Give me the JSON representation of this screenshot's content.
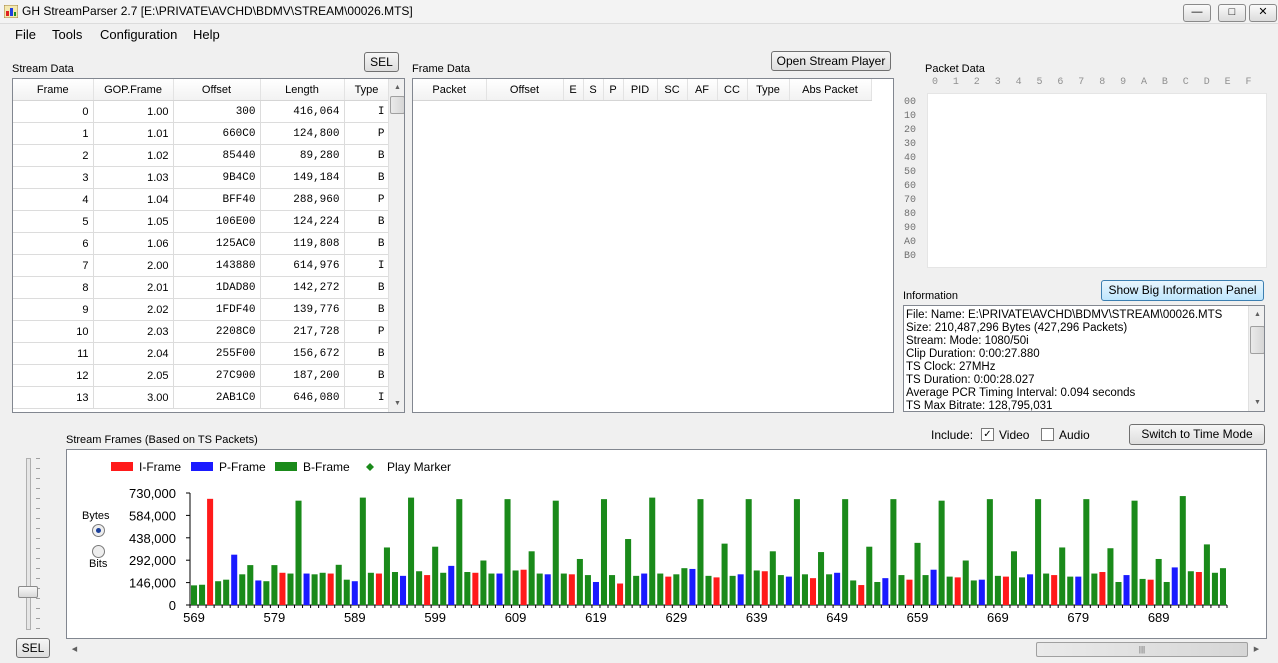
{
  "window": {
    "title": "GH StreamParser 2.7 [E:\\PRIVATE\\AVCHD\\BDMV\\STREAM\\00026.MTS]",
    "minimize": "—",
    "maximize": "□",
    "close": "✕"
  },
  "menu": [
    "File",
    "Tools",
    "Configuration",
    "Help"
  ],
  "stream_data": {
    "label": "Stream Data",
    "sel_label": "SEL",
    "columns": [
      "Frame",
      "GOP.Frame",
      "Offset",
      "Length",
      "Type"
    ],
    "rows": [
      [
        "0",
        "1.00",
        "300",
        "416,064",
        "I"
      ],
      [
        "1",
        "1.01",
        "660C0",
        "124,800",
        "P"
      ],
      [
        "2",
        "1.02",
        "85440",
        "89,280",
        "B"
      ],
      [
        "3",
        "1.03",
        "9B4C0",
        "149,184",
        "B"
      ],
      [
        "4",
        "1.04",
        "BFF40",
        "288,960",
        "P"
      ],
      [
        "5",
        "1.05",
        "106E00",
        "124,224",
        "B"
      ],
      [
        "6",
        "1.06",
        "125AC0",
        "119,808",
        "B"
      ],
      [
        "7",
        "2.00",
        "143880",
        "614,976",
        "I"
      ],
      [
        "8",
        "2.01",
        "1DAD80",
        "142,272",
        "B"
      ],
      [
        "9",
        "2.02",
        "1FDF40",
        "139,776",
        "B"
      ],
      [
        "10",
        "2.03",
        "2208C0",
        "217,728",
        "P"
      ],
      [
        "11",
        "2.04",
        "255F00",
        "156,672",
        "B"
      ],
      [
        "12",
        "2.05",
        "27C900",
        "187,200",
        "B"
      ],
      [
        "13",
        "3.00",
        "2AB1C0",
        "646,080",
        "I"
      ]
    ]
  },
  "frame_data": {
    "label": "Frame Data",
    "open_player_label": "Open Stream Player",
    "columns": [
      "Packet",
      "Offset",
      "E",
      "S",
      "P",
      "PID",
      "SC",
      "AF",
      "CC",
      "Type",
      "Abs Packet"
    ]
  },
  "packet_data": {
    "label": "Packet Data",
    "hex_columns": [
      "0",
      "1",
      "2",
      "3",
      "4",
      "5",
      "6",
      "7",
      "8",
      "9",
      "A",
      "B",
      "C",
      "D",
      "E",
      "F"
    ],
    "row_labels": [
      "00",
      "10",
      "20",
      "30",
      "40",
      "50",
      "60",
      "70",
      "80",
      "90",
      "A0",
      "B0"
    ]
  },
  "information": {
    "label": "Information",
    "big_panel_label": "Show Big Information Panel",
    "lines": [
      "File:   Name: E:\\PRIVATE\\AVCHD\\BDMV\\STREAM\\00026.MTS",
      "    Size: 210,487,296 Bytes (427,296 Packets)",
      "Stream: Mode: 1080/50i",
      "    Clip Duration: 0:00:27.880",
      "    TS Clock: 27MHz",
      "    TS Duration:   0:00:28.027",
      "    Average PCR Timing Interval: 0.094 seconds",
      "    TS Max Bitrate: 128,795,031"
    ]
  },
  "stream_frames": {
    "label": "Stream Frames (Based on TS Packets)",
    "include_label": "Include:",
    "video_label": "Video",
    "video_checked": true,
    "audio_label": "Audio",
    "audio_checked": false,
    "switch_label": "Switch to Time Mode",
    "bytes_label": "Bytes",
    "bits_label": "Bits",
    "units_selected": "Bytes",
    "sel_label": "SEL",
    "scroll_grip": "|||"
  },
  "chart_data": {
    "type": "bar",
    "legend": [
      {
        "name": "I-Frame",
        "color": "#ff1a1a"
      },
      {
        "name": "P-Frame",
        "color": "#1a1aff"
      },
      {
        "name": "B-Frame",
        "color": "#1a8a1a"
      },
      {
        "name": "Play Marker",
        "color": "#1a8a1a",
        "marker": "diamond"
      }
    ],
    "ylim": [
      0,
      730000
    ],
    "yticks": [
      0,
      146000,
      292000,
      438000,
      584000,
      730000
    ],
    "ytick_labels": [
      "0",
      "146,000",
      "292,000",
      "438,000",
      "584,000",
      "730,000"
    ],
    "x_start": 569,
    "xticks": [
      569,
      579,
      589,
      599,
      609,
      619,
      629,
      639,
      649,
      659,
      669,
      679,
      689
    ],
    "frame_types": "BBIBBPBBPBBIBBPBBIBBPBBIBBPBBIBBPBBIBBPBBIBBPBBIBBPBBIBBPBBIBBPBBIBBPBBIBBPBBIBBPBBIBBPBBIBBPBBIBBPBBIBBPBBIBBPBBIBBPBBIBBPBBI",
    "values": [
      128000,
      132000,
      692000,
      155000,
      165000,
      328000,
      200000,
      260000,
      160000,
      155000,
      260000,
      210000,
      205000,
      680000,
      205000,
      200000,
      210000,
      205000,
      262000,
      165000,
      155000,
      700000,
      210000,
      205000,
      375000,
      215000,
      190000,
      700000,
      220000,
      195000,
      380000,
      210000,
      255000,
      690000,
      215000,
      210000,
      290000,
      205000,
      205000,
      690000,
      225000,
      230000,
      350000,
      205000,
      200000,
      680000,
      205000,
      200000,
      300000,
      195000,
      150000,
      690000,
      195000,
      140000,
      430000,
      190000,
      205000,
      700000,
      205000,
      185000,
      200000,
      240000,
      235000,
      690000,
      190000,
      180000,
      400000,
      190000,
      200000,
      690000,
      225000,
      220000,
      350000,
      195000,
      185000,
      690000,
      200000,
      175000,
      345000,
      200000,
      210000,
      690000,
      160000,
      130000,
      380000,
      150000,
      175000,
      690000,
      195000,
      165000,
      405000,
      195000,
      230000,
      680000,
      185000,
      180000,
      290000,
      160000,
      165000,
      690000,
      190000,
      185000,
      350000,
      180000,
      200000,
      690000,
      205000,
      195000,
      375000,
      185000,
      185000,
      690000,
      205000,
      215000,
      370000,
      150000,
      195000,
      680000,
      170000,
      165000,
      300000,
      150000,
      245000,
      710000,
      220000,
      215000,
      395000,
      210000,
      240000
    ]
  }
}
